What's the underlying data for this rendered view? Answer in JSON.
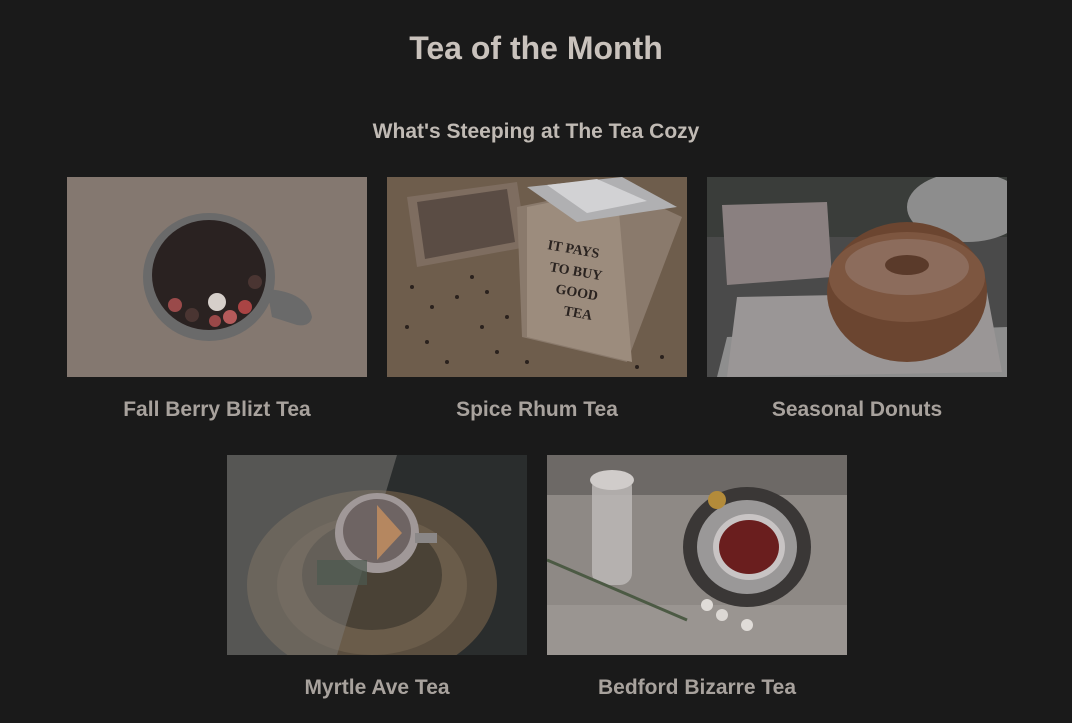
{
  "page": {
    "title": "Tea of the Month",
    "subtitle": "What's Steeping at The Tea Cozy"
  },
  "items": [
    {
      "label": "Fall Berry Blizt Tea",
      "image": "berry-tea-cup-photo"
    },
    {
      "label": "Spice Rhum Tea",
      "image": "tea-box-photo",
      "box_text": "IT PAYS TO BUY GOOD TEA"
    },
    {
      "label": "Seasonal Donuts",
      "image": "donut-photo"
    },
    {
      "label": "Myrtle Ave Tea",
      "image": "tea-cup-on-wood-photo"
    },
    {
      "label": "Bedford Bizarre Tea",
      "image": "red-tea-cup-with-jar-photo"
    }
  ],
  "colors": {
    "background": "#1a1a1a",
    "title": "#c9c2bc",
    "label": "#a8a29d"
  }
}
